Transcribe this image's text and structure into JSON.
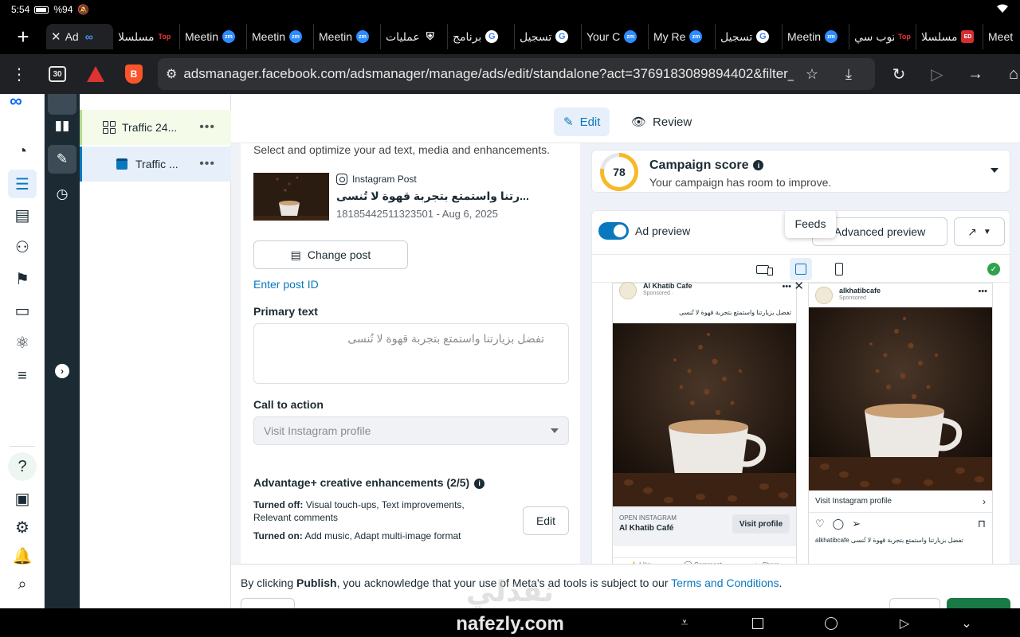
{
  "status_bar": {
    "time": "5:54",
    "battery": "%94"
  },
  "tabs": [
    {
      "label": "Ad",
      "icon": "meta-icon",
      "active": true
    },
    {
      "label": "مسلسلا",
      "icon": "top-icon"
    },
    {
      "label": "Meetin",
      "icon": "zoom-icon"
    },
    {
      "label": "Meetin",
      "icon": "zoom-icon"
    },
    {
      "label": "Meetin",
      "icon": "zoom-icon"
    },
    {
      "label": "عمليات",
      "icon": "shield-icon"
    },
    {
      "label": "برنامج",
      "icon": "google-icon"
    },
    {
      "label": "تسجيل",
      "icon": "google-icon"
    },
    {
      "label": "Your C",
      "icon": "zoom-icon"
    },
    {
      "label": "My Re",
      "icon": "zoom-icon"
    },
    {
      "label": "تسجيل",
      "icon": "google-icon"
    },
    {
      "label": "Meetin",
      "icon": "zoom-icon"
    },
    {
      "label": "توب سي",
      "icon": "top-icon"
    },
    {
      "label": "مسلسلا",
      "icon": "ed-icon"
    },
    {
      "label": "Meet",
      "icon": "none"
    }
  ],
  "toolbar": {
    "tab_count": "30",
    "url": "adsmanager.facebook.com/adsmanager/manage/ads/edit/standalone?act=3769183089894402&filter_set="
  },
  "tree": {
    "adset_label": "Traffic 24...",
    "ad_label": "Traffic ...",
    "more": "•••"
  },
  "header": {
    "edit_label": "Edit",
    "review_label": "Review"
  },
  "editor": {
    "intro": "Select and optimize your ad text, media and enhancements.",
    "post_source": "Instagram Post",
    "post_caption": "...رتنا واستمتع بتجربة قهوة لا تُنسى",
    "post_id": "18185442511323501 - Aug 6, 2025",
    "change_post": "Change post",
    "enter_post_id": "Enter post ID",
    "primary_text_label": "Primary text",
    "primary_text_value": "تفضل بزيارتنا واستمتع بتجربة قهوة لا تُنسى",
    "cta_label": "Call to action",
    "cta_value": "Visit Instagram profile",
    "enh_title": "Advantage+ creative enhancements (2/5)",
    "turned_off_label": "Turned off:",
    "turned_off_value": "Visual touch-ups, Text improvements, Relevant comments",
    "turned_on_label": "Turned on:",
    "turned_on_value": "Add music, Adapt multi-image format",
    "edit_button": "Edit"
  },
  "score": {
    "value": "78",
    "value_fraction": 0.78,
    "title": "Campaign score",
    "subtitle": "Your campaign has room to improve."
  },
  "preview": {
    "toggle_label": "Ad preview",
    "advanced_preview": "Advanced preview",
    "tooltip": "Feeds",
    "fb": {
      "page_name": "Al Khatib Cafe",
      "sponsored": "Sponsored ·",
      "body": "تفضل بزيارتنا واستمتع بتجربة قهوة لا تُنسى",
      "open_label": "OPEN INSTAGRAM",
      "page_label": "Al Khatib Café",
      "cta_button": "Visit profile",
      "like": "Like",
      "comment": "Comment",
      "share": "Share"
    },
    "ig": {
      "handle": "alkhatibcafe",
      "sponsored": "Sponsored",
      "cta": "Visit Instagram profile",
      "caption": "alkhatibcafe تفضل بزيارتنا واستمتع بتجربة قهوة لا تُنسى"
    }
  },
  "footer": {
    "legal_prefix": "By clicking",
    "legal_bold": "Publish",
    "legal_mid": ", you acknowledge that your use of Meta's ad tools is subject to our",
    "legal_link": "Terms and Conditions",
    "legal_end": "."
  },
  "watermark": {
    "arabic": "نفذلي",
    "latin": "nafezly.com"
  },
  "colors": {
    "accent": "#0a78be",
    "publish": "#1a7a45",
    "score_ring": "#f7b928",
    "toolstrip": "#1c2b33"
  }
}
